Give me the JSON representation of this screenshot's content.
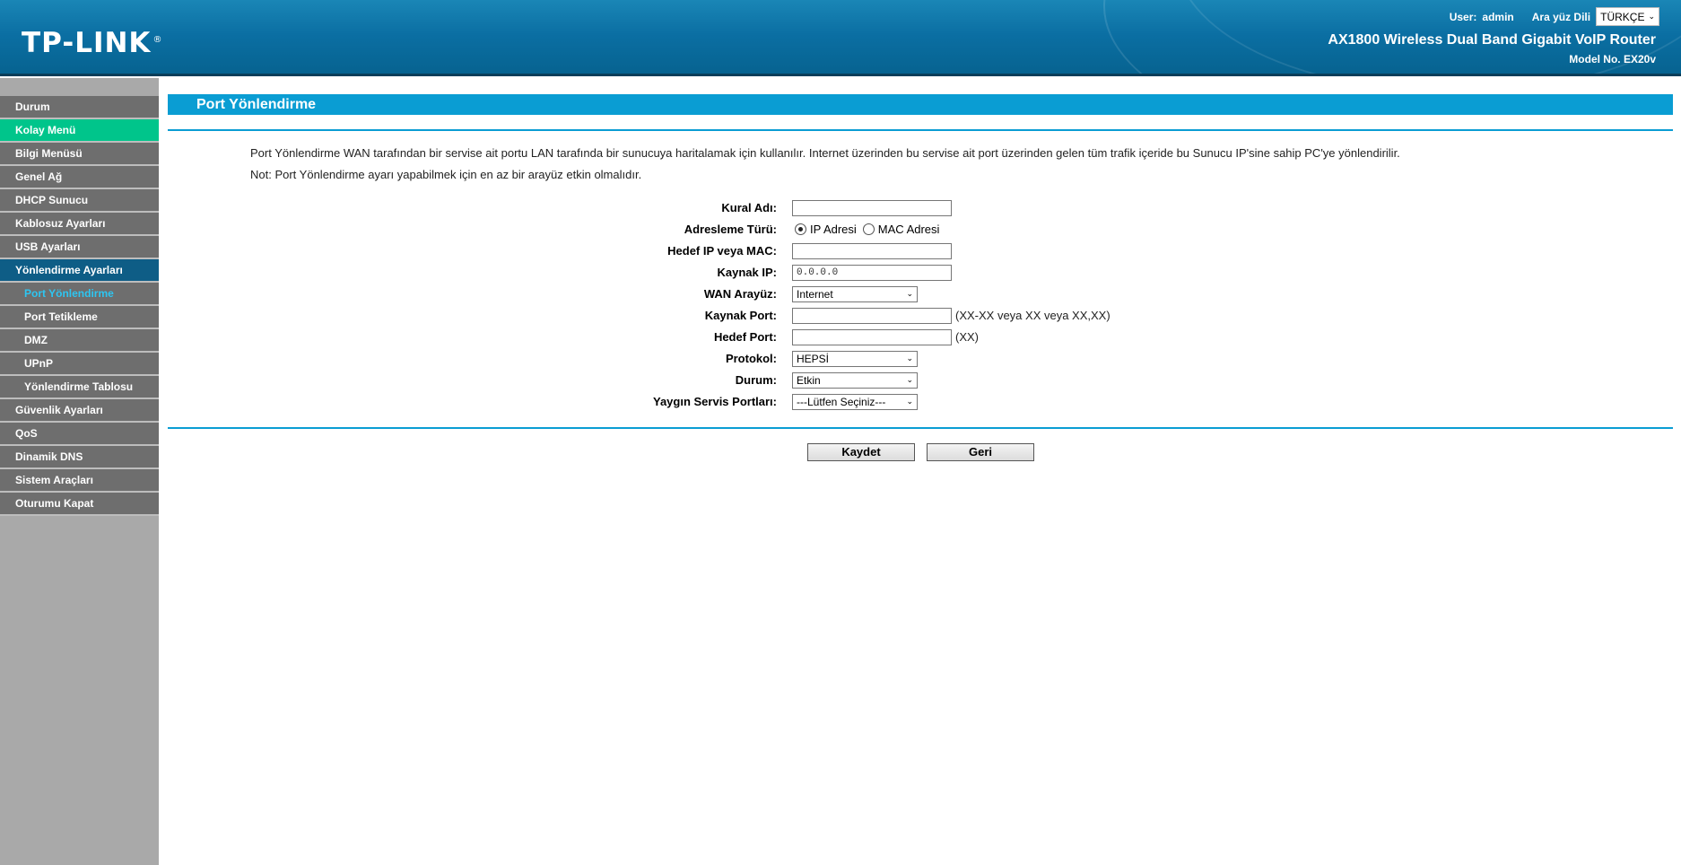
{
  "header": {
    "logo": "TP-LINK",
    "logo_mark": "®",
    "user_label": "User:",
    "user_value": "admin",
    "lang_label": "Ara yüz Dili",
    "lang_value": "TÜRKÇE",
    "product": "AX1800 Wireless Dual Band Gigabit VoIP Router",
    "model": "Model No. EX20v"
  },
  "sidebar": {
    "items": [
      {
        "label": "Durum"
      },
      {
        "label": "Kolay Menü"
      },
      {
        "label": "Bilgi Menüsü"
      },
      {
        "label": "Genel Ağ"
      },
      {
        "label": "DHCP Sunucu"
      },
      {
        "label": "Kablosuz Ayarları"
      },
      {
        "label": "USB Ayarları"
      },
      {
        "label": "Yönlendirme Ayarları"
      },
      {
        "label": "Port Yönlendirme"
      },
      {
        "label": "Port Tetikleme"
      },
      {
        "label": "DMZ"
      },
      {
        "label": "UPnP"
      },
      {
        "label": "Yönlendirme Tablosu"
      },
      {
        "label": "Güvenlik Ayarları"
      },
      {
        "label": "QoS"
      },
      {
        "label": "Dinamik DNS"
      },
      {
        "label": "Sistem Araçları"
      },
      {
        "label": "Oturumu Kapat"
      }
    ]
  },
  "main": {
    "title": "Port Yönlendirme",
    "description": "Port Yönlendirme WAN tarafından bir servise ait portu LAN tarafında bir sunucuya haritalamak için kullanılır. Internet üzerinden bu servise ait port üzerinden gelen tüm trafik içeride bu Sunucu IP'sine sahip PC'ye yönlendirilir.",
    "note": "Not: Port Yönlendirme ayarı yapabilmek için en az bir arayüz etkin olmalıdır."
  },
  "form": {
    "rule_name_label": "Kural Adı:",
    "rule_name_value": "",
    "addr_type_label": "Adresleme Türü:",
    "addr_ip": "IP Adresi",
    "addr_mac": "MAC Adresi",
    "dest_label": "Hedef IP veya MAC:",
    "dest_value": "",
    "source_ip_label": "Kaynak IP:",
    "source_ip_value": "0.0.0.0",
    "wan_label": "WAN Arayüz:",
    "wan_value": "Internet",
    "source_port_label": "Kaynak Port:",
    "source_port_value": "",
    "source_port_hint": "(XX-XX veya XX veya XX,XX)",
    "dest_port_label": "Hedef Port:",
    "dest_port_value": "",
    "dest_port_hint": "(XX)",
    "protocol_label": "Protokol:",
    "protocol_value": "HEPSİ",
    "status_label": "Durum:",
    "status_value": "Etkin",
    "service_label": "Yaygın Servis Portları:",
    "service_value": "---Lütfen Seçiniz---"
  },
  "buttons": {
    "save": "Kaydet",
    "back": "Geri"
  }
}
